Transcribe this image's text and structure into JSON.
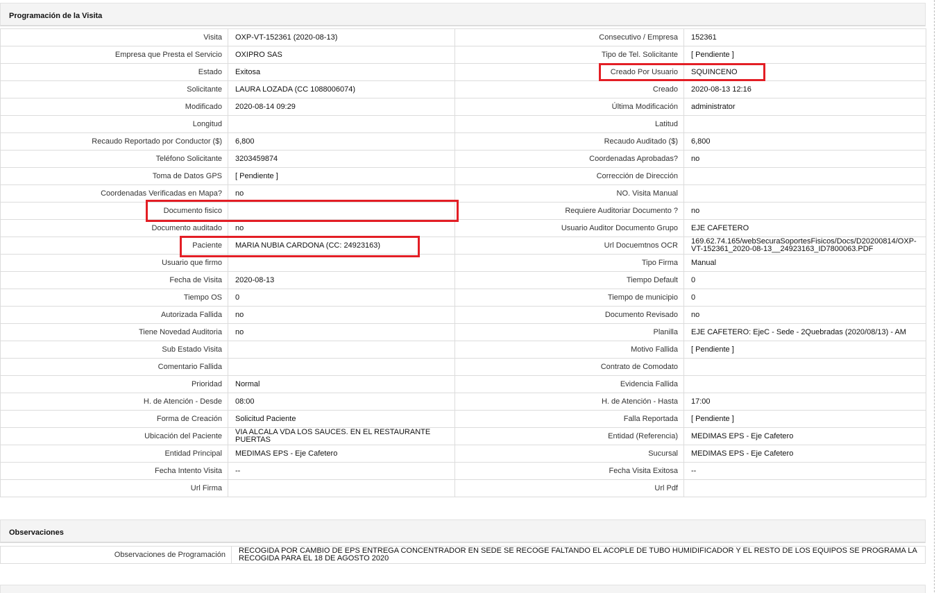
{
  "sections": {
    "programacion": "Programación de la Visita",
    "observaciones": "Observaciones"
  },
  "rows": [
    {
      "l1": "Visita",
      "v1": "OXP-VT-152361 (2020-08-13)",
      "l2": "Consecutivo / Empresa",
      "v2": "152361"
    },
    {
      "l1": "Empresa que Presta el Servicio",
      "v1": "OXIPRO SAS",
      "l2": "Tipo de Tel. Solicitante",
      "v2": "[ Pendiente ]"
    },
    {
      "l1": "Estado",
      "v1": "Exitosa",
      "l2": "Creado Por Usuario",
      "v2": "SQUINCENO"
    },
    {
      "l1": "Solicitante",
      "v1": "LAURA LOZADA (CC 1088006074)",
      "l2": "Creado",
      "v2": "2020-08-13 12:16"
    },
    {
      "l1": "Modificado",
      "v1": "2020-08-14 09:29",
      "l2": "Última Modificación",
      "v2": "administrator"
    },
    {
      "l1": "Longitud",
      "v1": "",
      "l2": "Latitud",
      "v2": ""
    },
    {
      "l1": "Recaudo Reportado por Conductor ($)",
      "v1": "6,800",
      "l2": "Recaudo Auditado ($)",
      "v2": "6,800"
    },
    {
      "l1": "Teléfono Solicitante",
      "v1": "3203459874",
      "l2": "Coordenadas Aprobadas?",
      "v2": "no"
    },
    {
      "l1": "Toma de Datos GPS",
      "v1": "[ Pendiente ]",
      "l2": "Corrección de Dirección",
      "v2": ""
    },
    {
      "l1": "Coordenadas Verificadas en Mapa?",
      "v1": "no",
      "l2": "NO. Visita Manual",
      "v2": ""
    },
    {
      "l1": "Documento fisico",
      "v1": "",
      "l2": "Requiere Auditoriar Documento ?",
      "v2": "no"
    },
    {
      "l1": "Documento auditado",
      "v1": "no",
      "l2": "Usuario Auditor Documento Grupo",
      "v2": "EJE CAFETERO"
    },
    {
      "l1": "Paciente",
      "v1": "MARIA NUBIA CARDONA (CC: 24923163)",
      "l2": "Url Docuemtnos OCR",
      "v2": "169.62.74.165/webSecuraSoportesFisicos/Docs/D20200814/OXP-VT-152361_2020-08-13__24923163_ID7800063.PDF"
    },
    {
      "l1": "Usuario que firmo",
      "v1": "",
      "l2": "Tipo Firma",
      "v2": "Manual"
    },
    {
      "l1": "Fecha de Visita",
      "v1": "2020-08-13",
      "l2": "Tiempo Default",
      "v2": "0"
    },
    {
      "l1": "Tiempo OS",
      "v1": "0",
      "l2": "Tiempo de municipio",
      "v2": "0"
    },
    {
      "l1": "Autorizada Fallida",
      "v1": "no",
      "l2": "Documento Revisado",
      "v2": "no"
    },
    {
      "l1": "Tiene Novedad Auditoria",
      "v1": "no",
      "l2": "Planilla",
      "v2": "EJE CAFETERO: EjeC - Sede - 2Quebradas (2020/08/13) - AM"
    },
    {
      "l1": "Sub Estado Visita",
      "v1": "",
      "l2": "Motivo Fallida",
      "v2": "[ Pendiente ]"
    },
    {
      "l1": "Comentario Fallida",
      "v1": "",
      "l2": "Contrato de Comodato",
      "v2": ""
    },
    {
      "l1": "Prioridad",
      "v1": "Normal",
      "l2": "Evidencia Fallida",
      "v2": ""
    },
    {
      "l1": "H. de Atención - Desde",
      "v1": "08:00",
      "l2": "H. de Atención - Hasta",
      "v2": "17:00"
    },
    {
      "l1": "Forma de Creación",
      "v1": "Solicitud Paciente",
      "l2": "Falla Reportada",
      "v2": "[ Pendiente ]"
    },
    {
      "l1": "Ubicación del Paciente",
      "v1": "VIA ALCALA VDA LOS SAUCES. EN EL RESTAURANTE PUERTAS",
      "l2": "Entidad (Referencia)",
      "v2": "MEDIMAS EPS - Eje Cafetero"
    },
    {
      "l1": "Entidad Principal",
      "v1": "MEDIMAS EPS - Eje Cafetero",
      "l2": "Sucursal",
      "v2": "MEDIMAS EPS - Eje Cafetero"
    },
    {
      "l1": "Fecha Intento Visita",
      "v1": "--",
      "l2": "Fecha Visita Exitosa",
      "v2": "--"
    },
    {
      "l1": "Url Firma",
      "v1": "",
      "l2": "Url Pdf",
      "v2": ""
    }
  ],
  "observaciones": {
    "label": "Observaciones de Programación",
    "value": "RECOGIDA POR CAMBIO DE EPS ENTREGA CONCENTRADOR EN SEDE SE RECOGE FALTANDO EL ACOPLE DE TUBO HUMIDIFICADOR Y EL RESTO DE LOS EQUIPOS SE PROGRAMA LA RECOGIDA PARA EL 18 DE AGOSTO 2020"
  },
  "colors": {
    "highlight": "#e31e25",
    "border": "#dcdcdc",
    "header_bg": "#f4f4f4"
  }
}
